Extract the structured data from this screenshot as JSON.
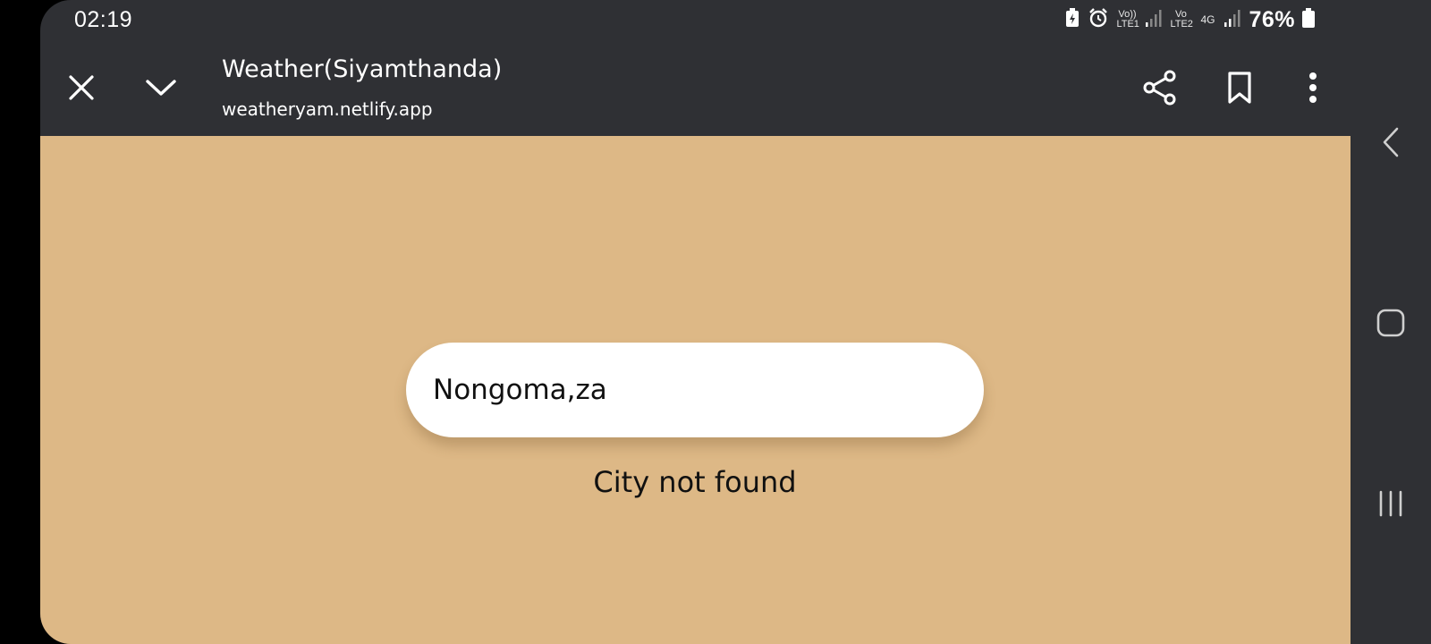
{
  "status_bar": {
    "time": "02:19",
    "sim1_label": "Vo)) LTE1",
    "sim2_label": "Vo LTE2",
    "network_type": "4G",
    "battery_percent": "76%",
    "icons": [
      "battery-saver-icon",
      "alarm-icon",
      "signal-icon",
      "battery-icon"
    ]
  },
  "toolbar": {
    "title": "Weather(Siyamthanda)",
    "url": "weatheryam.netlify.app",
    "icons": [
      "close-icon",
      "chevron-down-icon",
      "share-icon",
      "bookmark-icon",
      "more-vert-icon"
    ]
  },
  "page": {
    "search_value": "Nongoma,za",
    "error_message": "City not found",
    "background_color": "#ddb886"
  },
  "navigation_bar": {
    "icons": [
      "back-icon",
      "home-icon",
      "recents-icon"
    ]
  }
}
